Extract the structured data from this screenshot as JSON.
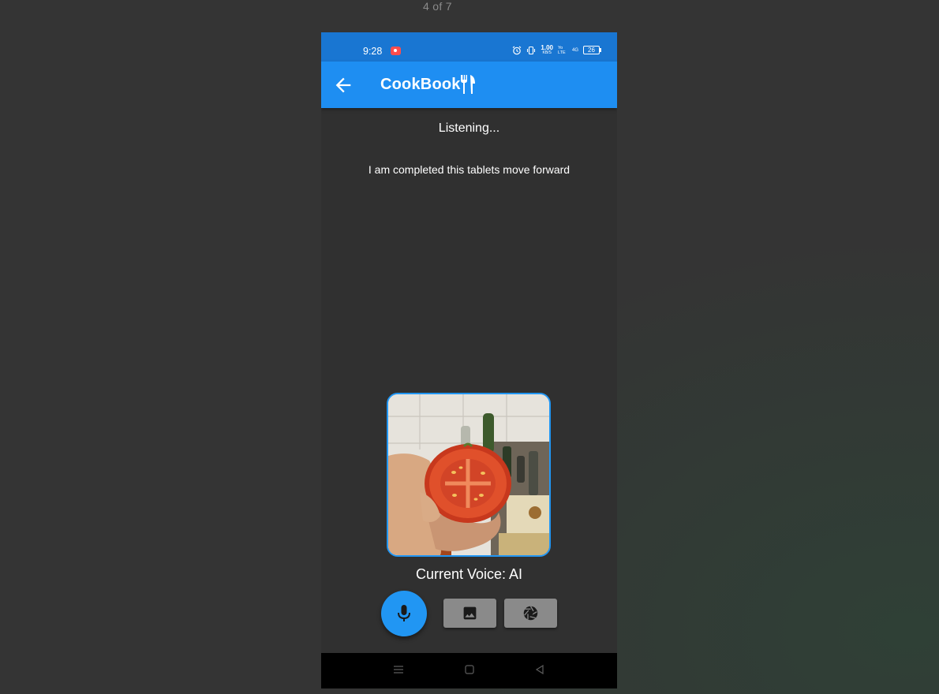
{
  "viewer": {
    "page_counter": "4 of 7"
  },
  "status_bar": {
    "time": "9:28",
    "speed_value": "1.00",
    "speed_unit": "KB/S",
    "network_1": "Yo LTE",
    "network_2": "4G",
    "battery": "26"
  },
  "app_bar": {
    "title": "CookBook",
    "back_icon": "arrow-back-icon",
    "title_icon": "fork-knife-icon"
  },
  "main": {
    "status_text": "Listening...",
    "transcript": "I am completed this tablets move forward",
    "photo_description_icon": "tomato-photo",
    "voice_label": "Current Voice: AI"
  },
  "actions": {
    "mic_icon": "mic-icon",
    "gallery_icon": "image-icon",
    "camera_icon": "camera-shutter-icon"
  },
  "navigation": {
    "items": [
      "menu-icon",
      "home-square-icon",
      "back-triangle-icon"
    ]
  },
  "colors": {
    "status_bar": "#1976d2",
    "app_bar": "#1e8ef2",
    "accent": "#2196f3",
    "background": "#303030",
    "button_gray": "#8a8a8a"
  }
}
